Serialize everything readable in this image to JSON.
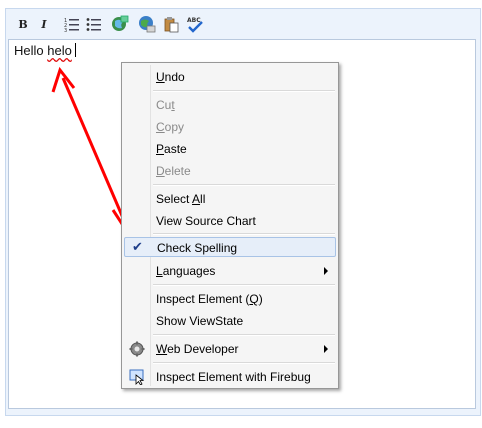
{
  "toolbar": {
    "bold_label": "B",
    "italic_label": "I",
    "icons": [
      "ordered-list-icon",
      "unordered-list-icon",
      "insert-link-icon",
      "globe-icon",
      "paste-icon",
      "spell-check-icon"
    ]
  },
  "editor": {
    "text_before": "Hello ",
    "misspelled_word": "helo"
  },
  "context_menu": {
    "items": [
      {
        "pre": "",
        "u": "U",
        "post": "ndo",
        "state": "enabled"
      },
      {
        "pre": "Cu",
        "u": "t",
        "post": "",
        "state": "disabled"
      },
      {
        "pre": "",
        "u": "C",
        "post": "opy",
        "state": "disabled"
      },
      {
        "pre": "",
        "u": "P",
        "post": "aste",
        "state": "enabled"
      },
      {
        "pre": "",
        "u": "D",
        "post": "elete",
        "state": "disabled"
      },
      {
        "pre": "Select ",
        "u": "A",
        "post": "ll",
        "state": "enabled"
      },
      {
        "pre": "View Source Chart",
        "u": "",
        "post": "",
        "state": "enabled"
      },
      {
        "pre": "Check Spelling",
        "u": "",
        "post": "",
        "state": "checked",
        "check_glyph": "✔"
      },
      {
        "pre": "",
        "u": "L",
        "post": "anguages",
        "state": "enabled",
        "submenu": true
      },
      {
        "pre": "Inspect Element (",
        "u": "Q",
        "post": ")",
        "state": "enabled"
      },
      {
        "pre": "Show ViewState",
        "u": "",
        "post": "",
        "state": "enabled"
      },
      {
        "pre": "",
        "u": "W",
        "post": "eb Developer",
        "state": "enabled",
        "submenu": true,
        "icon": "gear-icon"
      },
      {
        "pre": "Inspect Element with Firebug",
        "u": "",
        "post": "",
        "state": "enabled",
        "icon": "firebug-inspect-icon"
      }
    ]
  },
  "colors": {
    "annotation_arrow": "#ff0000",
    "menu_highlight": "#e6eef9",
    "spell_underline": "#e01010"
  }
}
